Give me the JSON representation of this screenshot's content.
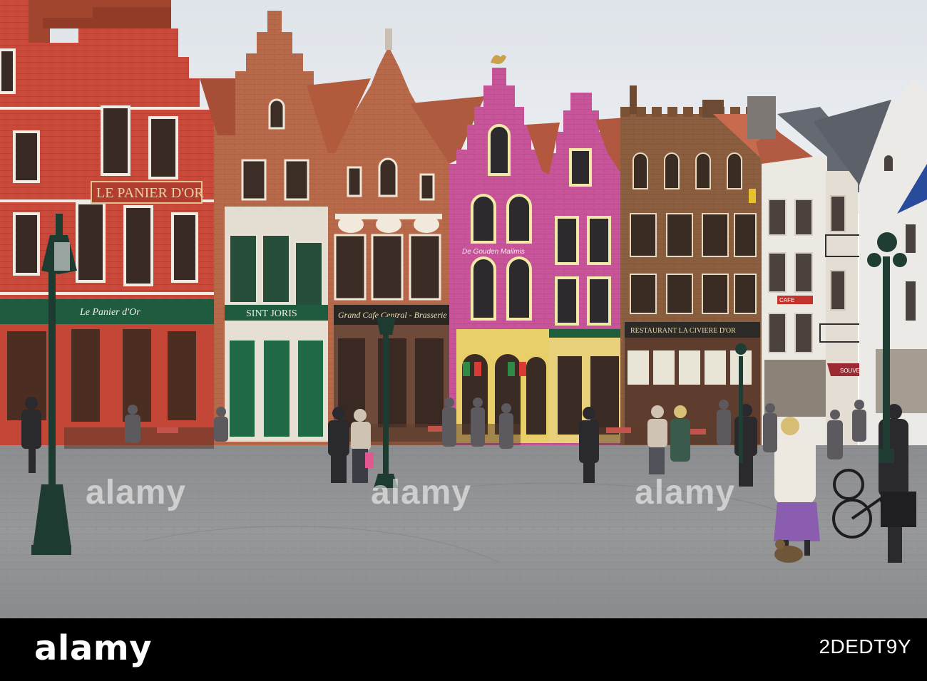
{
  "scene": {
    "signs": {
      "le_panier_dor_top": "LE PANIER D'OR",
      "le_panier_dor_awning": "Le Panier d'Or",
      "sint_joris": "SINT JORIS",
      "grand_cafe": "Grand Cafe Central - Brasserie",
      "pink_facade": "De Gouden Mailmis",
      "restaurant": "RESTAURANT LA CIVIERE D'OR",
      "small_red_sign": "CAFE",
      "souvenirs": "SOUVENIRS"
    },
    "colors": {
      "sky": "#e6eaee",
      "brick_red": "#c8493a",
      "pink_facade": "#c4508f",
      "green_trim": "#1e5e3a",
      "cobblestone": "#8d8e90",
      "white_house": "#e8e8e6"
    }
  },
  "watermark": {
    "text": "alamy"
  },
  "footer": {
    "logo": "alamy",
    "image_id": "2DEDT9Y"
  }
}
